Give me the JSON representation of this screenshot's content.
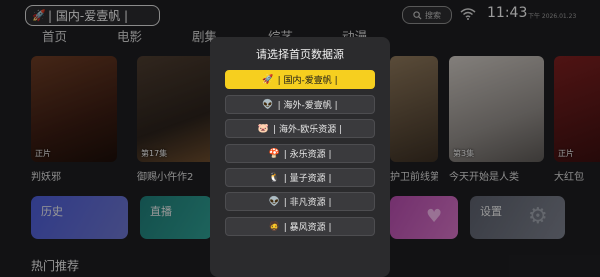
{
  "header": {
    "source_label": "| 国内-爱壹帆 |",
    "source_icon": "rocket-icon",
    "search_label": "搜索",
    "search_icon": "search-icon",
    "wifi_icon": "wifi-icon",
    "time": "11:43",
    "date": "下午 2026.01.23"
  },
  "nav": {
    "tabs": [
      "首页",
      "电影",
      "剧集",
      "综艺",
      "动漫"
    ]
  },
  "posters": [
    {
      "title": "判妖邪",
      "badge": "正片"
    },
    {
      "title": "御赐小仵作2",
      "badge": "第17集"
    },
    {
      "title": "",
      "badge": ""
    },
    {
      "title": "",
      "badge": ""
    },
    {
      "title": "护卫前线第",
      "badge": ""
    },
    {
      "title": "今天开始是人类",
      "badge": "第3集"
    },
    {
      "title": "大红包",
      "badge": "正片"
    }
  ],
  "tiles": {
    "history": "历史",
    "live": "直播",
    "favorite": "",
    "settings": "设置"
  },
  "section": {
    "hot_title": "热门推荐"
  },
  "dialog": {
    "title": "请选择首页数据源",
    "options": [
      {
        "label": "| 国内-爱壹帆 |",
        "icon": "🚀",
        "active": true
      },
      {
        "label": "| 海外-爱壹帆 |",
        "icon": "👽",
        "active": false
      },
      {
        "label": "| 海外-欧乐资源 |",
        "icon": "🐷",
        "active": false
      },
      {
        "label": "| 永乐资源 |",
        "icon": "🍄",
        "active": false
      },
      {
        "label": "| 量子资源 |",
        "icon": "🐧",
        "active": false
      },
      {
        "label": "| 非凡资源 |",
        "icon": "👽",
        "active": false
      },
      {
        "label": "| 暴风资源 |",
        "icon": "🧔",
        "active": false
      }
    ]
  },
  "colors": {
    "background": "#1d1d20",
    "dialog": "#2b2b2d",
    "accent_yellow": "#f6cf1f",
    "tile_history": "#5a64c8",
    "tile_live": "#2a8a82",
    "tile_settings": "#c05ab8"
  }
}
